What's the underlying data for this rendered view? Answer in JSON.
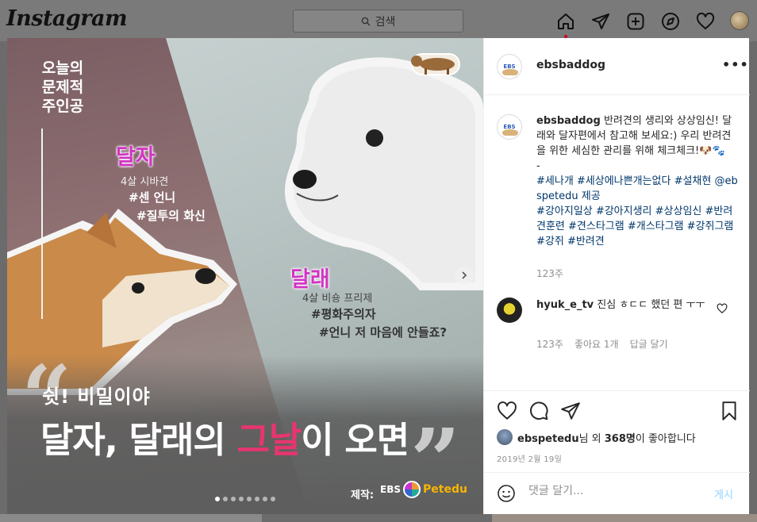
{
  "nav": {
    "logo": "Instagram",
    "search_placeholder": "검색",
    "icons": [
      "home-icon",
      "direct-message-icon",
      "new-post-icon",
      "explore-icon",
      "activity-heart-icon",
      "profile-avatar"
    ]
  },
  "post": {
    "image": {
      "corner_title_lines": [
        "오늘의",
        "문제적",
        "주인공"
      ],
      "dog1": {
        "name": "달자",
        "meta": "4살 시바견",
        "tags": [
          "#센 언니",
          "#질투의 화신"
        ]
      },
      "dog2": {
        "name": "달래",
        "meta": "4살 비숑 프리제",
        "tags": [
          "#평화주의자",
          "#언니 저 마음에 안들죠?"
        ]
      },
      "slogan_small": "쉿! 비밀이야",
      "slogan_big_before": "달자, 달래의 ",
      "slogan_big_highlight": "그날",
      "slogan_big_after": "이 오면",
      "maker_label": "제작:",
      "maker_ebs": "EBS",
      "maker_pet": "Petedu",
      "slide_count": 8,
      "active_slide": 1
    },
    "author": "ebsbaddog",
    "more": "•••",
    "caption": {
      "username": "ebsbaddog",
      "text": "반려견의 생리와 상상임신! 달래와 달자편에서 참고해 보세요:) 우리 반려견을 위한 세심한 관리를 위해 체크체크!🐶🐾",
      "dash": "-",
      "hashtags_line1": "#세나개 #세상에나쁜개는없다 #설채현 @ebspetedu 제공",
      "hashtags_line2": "#강아지일상 #강아지생리 #상상임신 #반려견훈련 #견스타그램 #개스타그램 #강쥐그램 #강쥐 #반려견",
      "time": "123주"
    },
    "comment": {
      "username": "hyuk_e_tv",
      "text": "진심 ㅎㄷㄷ 했던 편 ㅜㅜ",
      "time": "123주",
      "likes": "좋아요 1개",
      "reply": "답글 달기"
    },
    "likes": {
      "user": "ebspetedu",
      "middle": "님 외 ",
      "count": "368명",
      "suffix": "이 좋아합니다"
    },
    "date": "2019년 2월 19일",
    "comment_input_placeholder": "댓글 달기...",
    "post_button": "게시"
  },
  "colors": {
    "accent_blue": "#0095f6",
    "post_button_disabled": "#b2dffc",
    "highlight_pink": "#e8356f",
    "name_purple": "#d233c4"
  }
}
